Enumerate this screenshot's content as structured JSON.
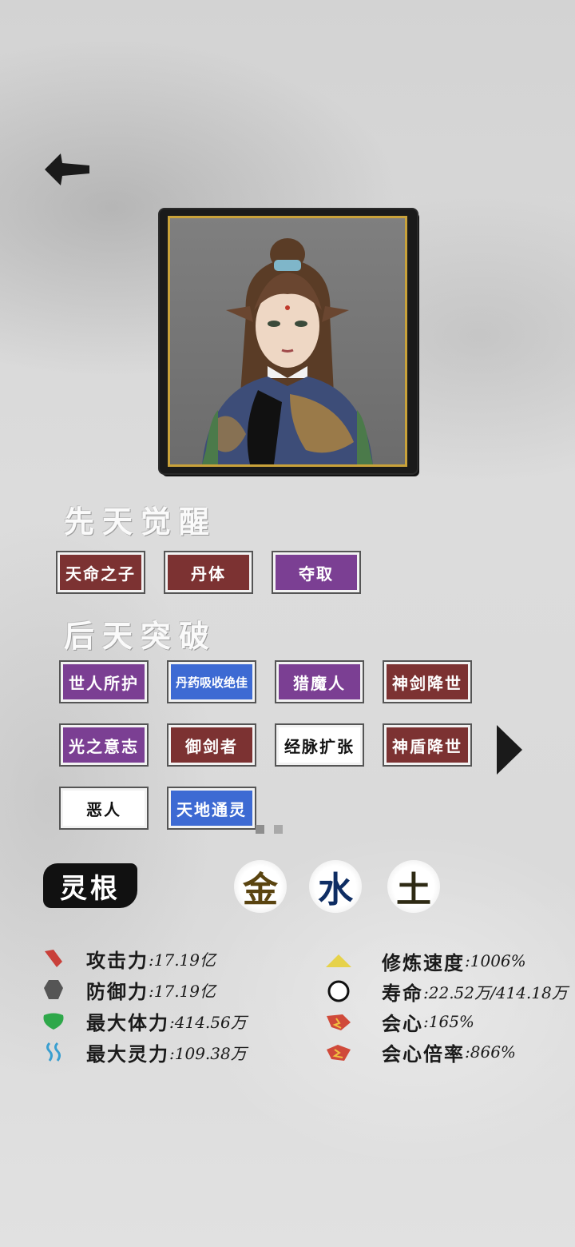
{
  "sections": {
    "innate_title": "先天觉醒",
    "acquired_title": "后天突破",
    "root_title": "灵根"
  },
  "innate_tags": [
    {
      "label": "天命之子",
      "color": "red"
    },
    {
      "label": "丹体",
      "color": "red"
    },
    {
      "label": "夺取",
      "color": "purple"
    }
  ],
  "acquired_tags": [
    {
      "label": "世人所护",
      "color": "purple"
    },
    {
      "label": "丹药吸收绝佳",
      "color": "blue"
    },
    {
      "label": "猎魔人",
      "color": "purple"
    },
    {
      "label": "神剑降世",
      "color": "red"
    },
    {
      "label": "光之意志",
      "color": "purple"
    },
    {
      "label": "御剑者",
      "color": "red"
    },
    {
      "label": "经脉扩张",
      "color": "white"
    },
    {
      "label": "神盾降世",
      "color": "red"
    },
    {
      "label": "恶人",
      "color": "white"
    },
    {
      "label": "天地通灵",
      "color": "blue"
    }
  ],
  "elements": [
    {
      "label": "金",
      "color": "#5a4410"
    },
    {
      "label": "水",
      "color": "#0e2d63"
    },
    {
      "label": "土",
      "color": "#2e2a14"
    }
  ],
  "stats_left": [
    {
      "label": "攻击力",
      "value": ":17.19亿",
      "icon": "sword-icon",
      "color": "#c9403a"
    },
    {
      "label": "防御力",
      "value": ":17.19亿",
      "icon": "shield-icon",
      "color": "#555555"
    },
    {
      "label": "最大体力",
      "value": ":414.56万",
      "icon": "health-icon",
      "color": "#2ea84a"
    },
    {
      "label": "最大灵力",
      "value": ":109.38万",
      "icon": "spirit-icon",
      "color": "#3a9fd0"
    }
  ],
  "stats_right": [
    {
      "label": "修炼速度",
      "value": ":1006%",
      "icon": "cultivation-icon",
      "color": "#e6d24a"
    },
    {
      "label": "寿命",
      "value": ":22.52万/414.18万",
      "icon": "lifespan-icon",
      "color": "#111111"
    },
    {
      "label": "会心",
      "value": ":165%",
      "icon": "critical-icon",
      "color": "#d04a3a"
    },
    {
      "label": "会心倍率",
      "value": ":866%",
      "icon": "critical-rate-icon",
      "color": "#d04a3a"
    }
  ],
  "pagination": {
    "current": 1,
    "total": 2
  }
}
